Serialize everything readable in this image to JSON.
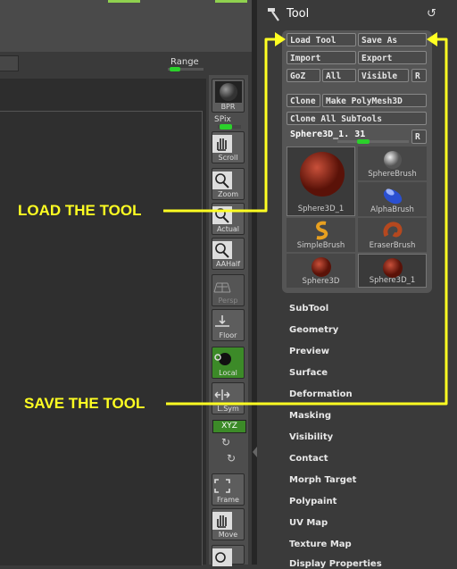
{
  "canvas": {
    "range_label": "Range",
    "spix_label": "SPix"
  },
  "shelf": {
    "buttons": [
      {
        "name": "bpr-button",
        "label": "BPR"
      },
      {
        "name": "scroll-button",
        "label": "Scroll"
      },
      {
        "name": "zoom-button",
        "label": "Zoom"
      },
      {
        "name": "actual-button",
        "label": "Actual"
      },
      {
        "name": "aahalf-button",
        "label": "AAHalf"
      },
      {
        "name": "persp-button",
        "label": "Persp"
      },
      {
        "name": "floor-button",
        "label": "Floor"
      },
      {
        "name": "local-button",
        "label": "Local"
      },
      {
        "name": "lsym-button",
        "label": "L.Sym"
      },
      {
        "name": "frame-button",
        "label": "Frame"
      },
      {
        "name": "move-button",
        "label": "Move"
      }
    ],
    "xyz_label": "XYZ"
  },
  "tool_panel": {
    "title": "Tool",
    "buttons": {
      "load_tool": "Load Tool",
      "save_as": "Save As",
      "import": "Import",
      "export": "Export",
      "goz": "GoZ",
      "all": "All",
      "visible": "Visible",
      "r": "R",
      "clone": "Clone",
      "make_polymesh": "Make PolyMesh3D",
      "clone_all_subtools": "Clone All SubTools"
    },
    "current_tool": {
      "name": "Sphere3D_1.",
      "value": "31"
    },
    "thumbnails": [
      {
        "label": "Sphere3D_1",
        "kind": "big-sphere"
      },
      {
        "label": "SphereBrush",
        "kind": "spherebrush"
      },
      {
        "label": "AlphaBrush",
        "kind": "alphabrush"
      },
      {
        "label": "SimpleBrush",
        "kind": "simplebrush"
      },
      {
        "label": "EraserBrush",
        "kind": "eraserbrush"
      },
      {
        "label": "Sphere3D",
        "kind": "sphere"
      },
      {
        "label": "Sphere3D_1",
        "kind": "sphere"
      }
    ],
    "sections": [
      "SubTool",
      "Geometry",
      "Preview",
      "Surface",
      "Deformation",
      "Masking",
      "Visibility",
      "Contact",
      "Morph Target",
      "Polypaint",
      "UV Map",
      "Texture Map",
      "Display Properties"
    ]
  },
  "annotations": {
    "load": "LOAD THE TOOL",
    "save": "SAVE THE TOOL",
    "color": "#ffff22"
  }
}
